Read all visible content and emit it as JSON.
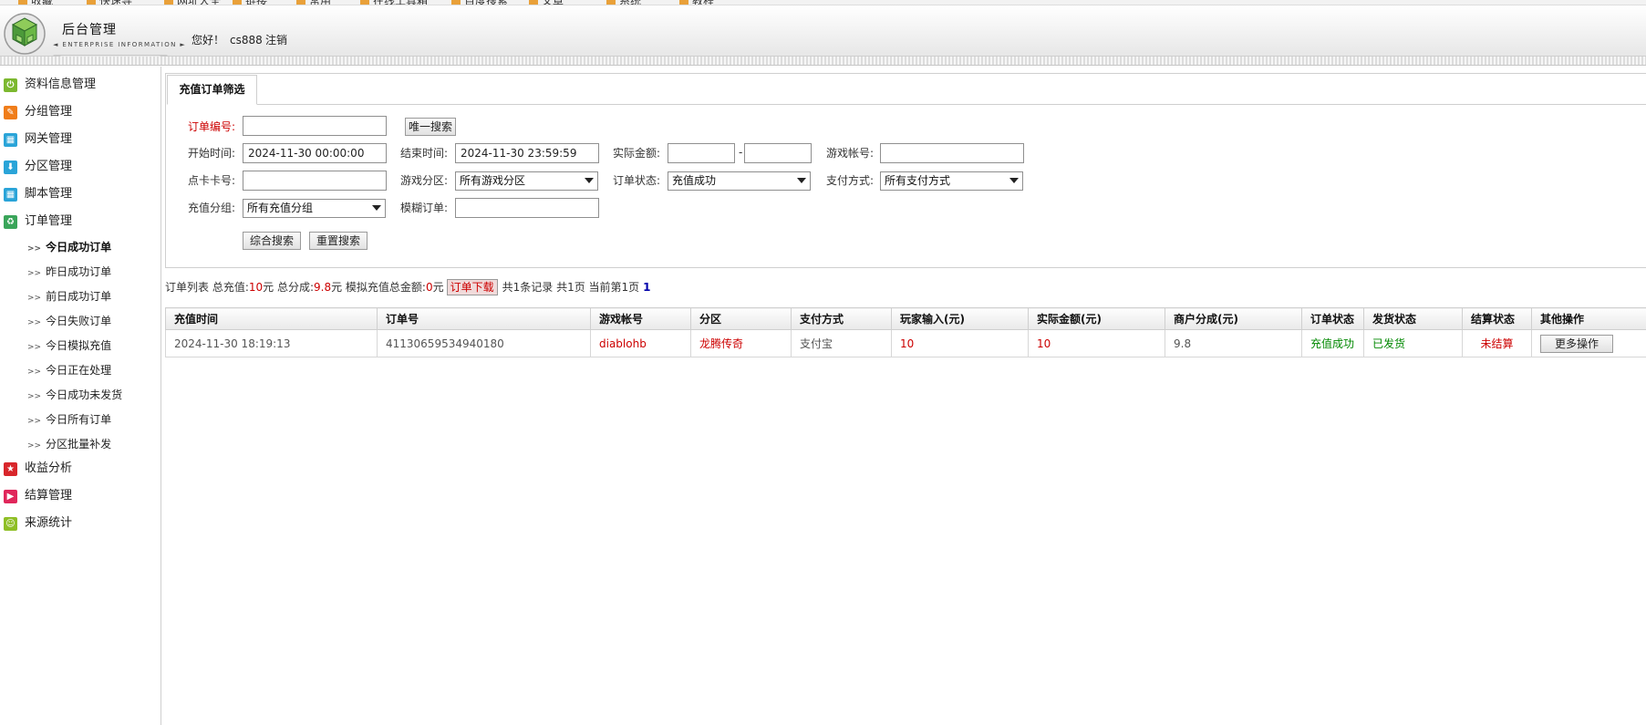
{
  "app": {
    "title": "后台管理",
    "subtitle": "◄ ENTERPRISE INFORMATION ►",
    "greeting": "您好！",
    "username": "cs888",
    "logout": "注销"
  },
  "bookmarks": [
    "收藏",
    "快速导",
    "网址大全",
    "链接",
    "常用",
    "在线工具箱",
    "百度搜索",
    "文章",
    "系统",
    "教程"
  ],
  "sidebar": {
    "items": [
      {
        "label": "资料信息管理",
        "icon": "power-icon",
        "color": "#7cb82f"
      },
      {
        "label": "分组管理",
        "icon": "pencil-icon",
        "color": "#f07d1a"
      },
      {
        "label": "网关管理",
        "icon": "grid-icon",
        "color": "#2aa4d8"
      },
      {
        "label": "分区管理",
        "icon": "download-icon",
        "color": "#2aa4d8"
      },
      {
        "label": "脚本管理",
        "icon": "grid-icon",
        "color": "#2aa4d8"
      },
      {
        "label": "订单管理",
        "icon": "recycle-icon",
        "color": "#3aa55a"
      }
    ],
    "sub_items": [
      "今日成功订单",
      "昨日成功订单",
      "前日成功订单",
      "今日失败订单",
      "今日模拟充值",
      "今日正在处理",
      "今日成功未发货",
      "今日所有订单",
      "分区批量补发"
    ],
    "active_sub": "今日成功订单",
    "bottom_items": [
      {
        "label": "收益分析",
        "icon": "star-icon",
        "color": "#d8262b"
      },
      {
        "label": "结算管理",
        "icon": "play-icon",
        "color": "#e0265a"
      },
      {
        "label": "来源统计",
        "icon": "smile-icon",
        "color": "#8fbf26"
      }
    ]
  },
  "filter": {
    "tab_label": "充值订单筛选",
    "order_no_label": "订单编号:",
    "order_no_value": "",
    "unique_search": "唯一搜索",
    "start_label": "开始时间:",
    "start_value": "2024-11-30 00:00:00",
    "end_label": "结束时间:",
    "end_value": "2024-11-30 23:59:59",
    "amount_label": "实际金额:",
    "amount_min": "",
    "amount_max": "",
    "dash": "-",
    "account_label": "游戏帐号:",
    "account_value": "",
    "card_label": "点卡卡号:",
    "card_value": "",
    "zone_label": "游戏分区:",
    "zone_value": "所有游戏分区",
    "status_label": "订单状态:",
    "status_value": "充值成功",
    "pay_label": "支付方式:",
    "pay_value": "所有支付方式",
    "group_label": "充值分组:",
    "group_value": "所有充值分组",
    "fuzzy_label": "模糊订单:",
    "fuzzy_value": "",
    "combined_search": "综合搜索",
    "reset_search": "重置搜索"
  },
  "summary": {
    "prefix": "订单列表 总充值:",
    "total": "10",
    "unit1": "元 总分成:",
    "share": "9.8",
    "unit2": "元 模拟充值总金额:",
    "sim": "0",
    "unit3": "元",
    "download": "订单下载",
    "records": "共1条记录 共1页 当前第1页",
    "page": "1"
  },
  "table": {
    "headers": [
      "充值时间",
      "订单号",
      "游戏帐号",
      "分区",
      "支付方式",
      "玩家输入(元)",
      "实际金额(元)",
      "商户分成(元)",
      "订单状态",
      "发货状态",
      "结算状态",
      "其他操作"
    ],
    "rows": [
      {
        "time": "2024-11-30 18:19:13",
        "order_no": "41130659534940180",
        "account": "diablohb",
        "zone": "龙腾传奇",
        "pay": "支付宝",
        "input": "10",
        "actual": "10",
        "share": "9.8",
        "status": "充值成功",
        "ship": "已发货",
        "settle": "未结算",
        "action": "更多操作"
      }
    ]
  }
}
